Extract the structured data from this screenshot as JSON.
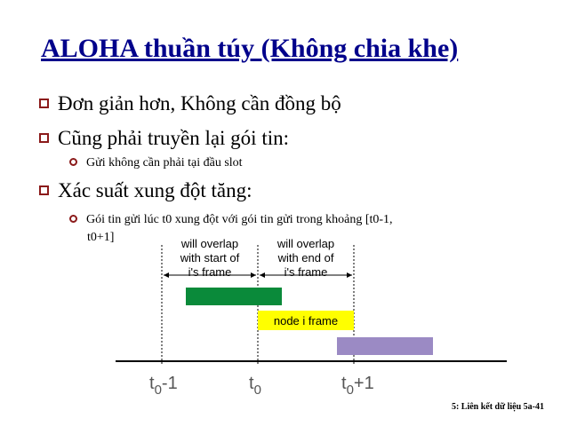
{
  "slide": {
    "title": "ALOHA thuần túy (Không chia khe)",
    "bullets": [
      {
        "text": "Đơn giản hơn, Không cần đồng bộ"
      },
      {
        "text": "Cũng phải truyền lại gói tin:"
      },
      {
        "text": "Gửi không cần phải tại đầu slot"
      },
      {
        "text": "Xác suất xung đột tăng:"
      },
      {
        "text": "Gói tin gửi lúc t0 xung đột với gói tin gửi trong khoảng  [t0-1,",
        "cont": "t0+1]"
      }
    ],
    "diagram": {
      "label_left": [
        "will overlap",
        "with start of",
        "i's frame"
      ],
      "label_right": [
        "will overlap",
        "with end of",
        "i's frame"
      ],
      "frame_label": "node i frame",
      "ticks": [
        {
          "base": "t",
          "sub": "0",
          "suffix": "-1"
        },
        {
          "base": "t",
          "sub": "0",
          "suffix": ""
        },
        {
          "base": "t",
          "sub": "0",
          "suffix": "+1"
        }
      ],
      "colors": {
        "green": "#0a8a3a",
        "yellow": "#ffff00",
        "purple": "#9b8ac4"
      }
    },
    "footer": "5: Liên kết dữ liệu   5a-41"
  }
}
